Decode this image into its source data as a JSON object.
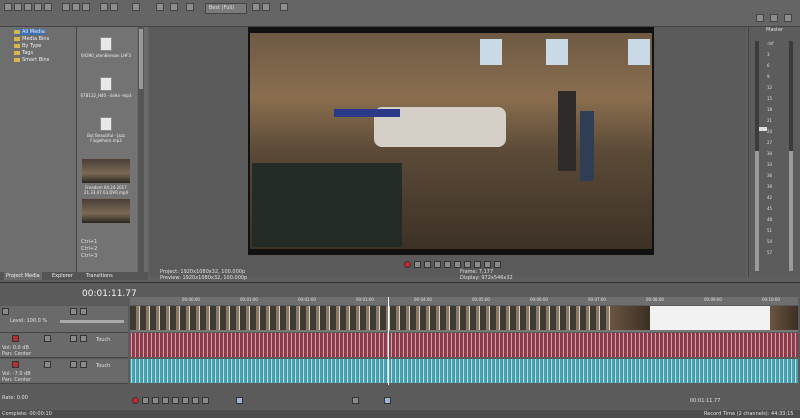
{
  "media_panel": {
    "tree": [
      "All Media",
      "Media Bins",
      "By Type",
      "Tags",
      "Smart Bins"
    ],
    "files": [
      {
        "name": "04390_otenBenson LHF3"
      },
      {
        "name": "67B112_H40 - ilsHa -mp3"
      },
      {
        "name": "But Beautiful - Jazz Flugelhorn.mp3"
      },
      {
        "name": "Freedom 04.24.2017 21.33.47.03.DVR.mp4"
      },
      {
        "name": ""
      }
    ],
    "shortcuts": [
      "Ctrl+1",
      "Ctrl+2",
      "Ctrl+3"
    ],
    "tabs": [
      "Project Media",
      "Explorer",
      "Transitions"
    ]
  },
  "preview": {
    "quality": "Best (Full)",
    "project_label": "Project:",
    "project_value": "1920x1080x32, 100.000p",
    "preview_label": "Preview:",
    "preview_value": "1920x1080x32, 100.000p",
    "frame_label": "Frame:",
    "frame_value": "7,177",
    "display_label": "Display:",
    "display_value": "972x546x32"
  },
  "master": {
    "title": "Master",
    "scale": [
      "-Inf",
      "3",
      "6",
      "9",
      "12",
      "15",
      "18",
      "21",
      "24",
      "27",
      "30",
      "33",
      "36",
      "39",
      "42",
      "45",
      "48",
      "51",
      "54",
      "57"
    ],
    "left_level": 0.52,
    "right_level": 0.52
  },
  "timeline": {
    "timecode": "00:01:11.77",
    "ruler": [
      "00:00:00",
      "00:01:00",
      "00:02:00",
      "00:03:00",
      "00:04:00",
      "00:05:00",
      "00:06:00",
      "00:07:00",
      "00:08:00",
      "00:09:00",
      "00:10:00"
    ],
    "video_track": {
      "level_label": "Level:",
      "level_value": "100.0 %"
    },
    "audio_tracks": [
      {
        "vol_label": "Vol:",
        "vol_value": "0.0 dB",
        "pan_label": "Pan:",
        "pan_value": "Center",
        "mode": "Touch"
      },
      {
        "vol_label": "Vol:",
        "vol_value": "-7.0 dB",
        "pan_label": "Pan:",
        "pan_value": "Center",
        "mode": "Touch"
      }
    ],
    "rate_label": "Rate:",
    "rate_value": "0.00",
    "cursor_time": "00:01:11.77",
    "record_info": "Record Time (2 channels): 44:33:15"
  },
  "status_bar": {
    "text": "Complete: 00:00:10"
  },
  "colors": {
    "bg": "#5f5f5f",
    "panel": "#6b6b6b",
    "audio_wave": "#8c3a4a",
    "audio_wave2": "#4aa3b0",
    "record": "#d0232b"
  }
}
